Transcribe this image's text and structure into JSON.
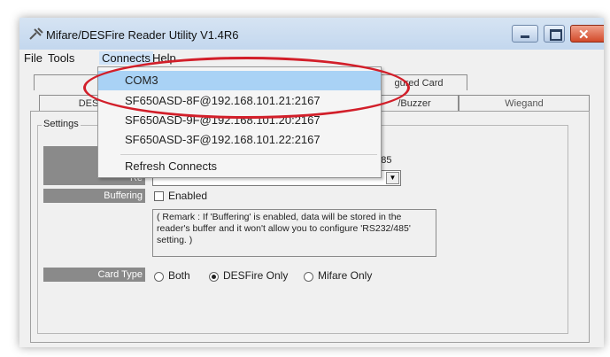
{
  "window": {
    "title": "Mifare/DESFire Reader Utility V1.4R6",
    "close_glyph": "✕"
  },
  "menubar": {
    "file": "File",
    "tools": "Tools",
    "connects": "Connects",
    "help": "Help"
  },
  "tabs": {
    "config_card": "gured Card",
    "des": "DES",
    "buzzer": "/Buzzer",
    "wiegand": "Wiegand"
  },
  "settings": {
    "legend": "Settings",
    "rs485_suffix": "2/485",
    "row3_label": "Re",
    "buffering_label": "Buffering",
    "buffering_checkbox": "Enabled",
    "buffering_checked": false,
    "remark": "( Remark : If 'Buffering' is enabled, data will be stored in the reader's buffer and it won't allow you to configure 'RS232/485' setting. )",
    "card_type_label": "Card Type",
    "card_type_options": [
      "Both",
      "DESFire Only",
      "Mifare Only"
    ],
    "card_type_selected": "DESFire Only"
  },
  "connects_menu": {
    "items": [
      "COM3",
      "SF650ASD-8F@192.168.101.21:2167",
      "SF650ASD-9F@192.168.101.20:2167",
      "SF650ASD-3F@192.168.101.22:2167",
      "Refresh Connects"
    ],
    "highlighted": "COM3"
  },
  "colors": {
    "annotation": "#d21f2a",
    "highlight": "#a9d2f5"
  }
}
